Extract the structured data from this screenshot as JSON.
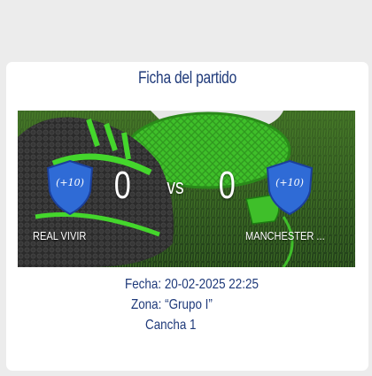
{
  "card": {
    "title": "Ficha del partido"
  },
  "match": {
    "home_team": "REAL VIVIR",
    "away_team": "MANCHESTER ...",
    "home_score": "0",
    "away_score": "0",
    "separator": "vs",
    "home_badge_text": "(+10)",
    "away_badge_text": "(+10)"
  },
  "details": {
    "fecha": "Fecha: 20-02-2025 22:25",
    "zona": "Zona: “Grupo I”",
    "cancha": "Cancha 1"
  },
  "icons": {
    "home_badge": "shield-icon",
    "away_badge": "shield-icon"
  },
  "colors": {
    "title_text": "#1f3a7a",
    "badge_fill": "#2f6bd6",
    "badge_border": "#1b3f9a",
    "score_text": "#ffffff"
  }
}
